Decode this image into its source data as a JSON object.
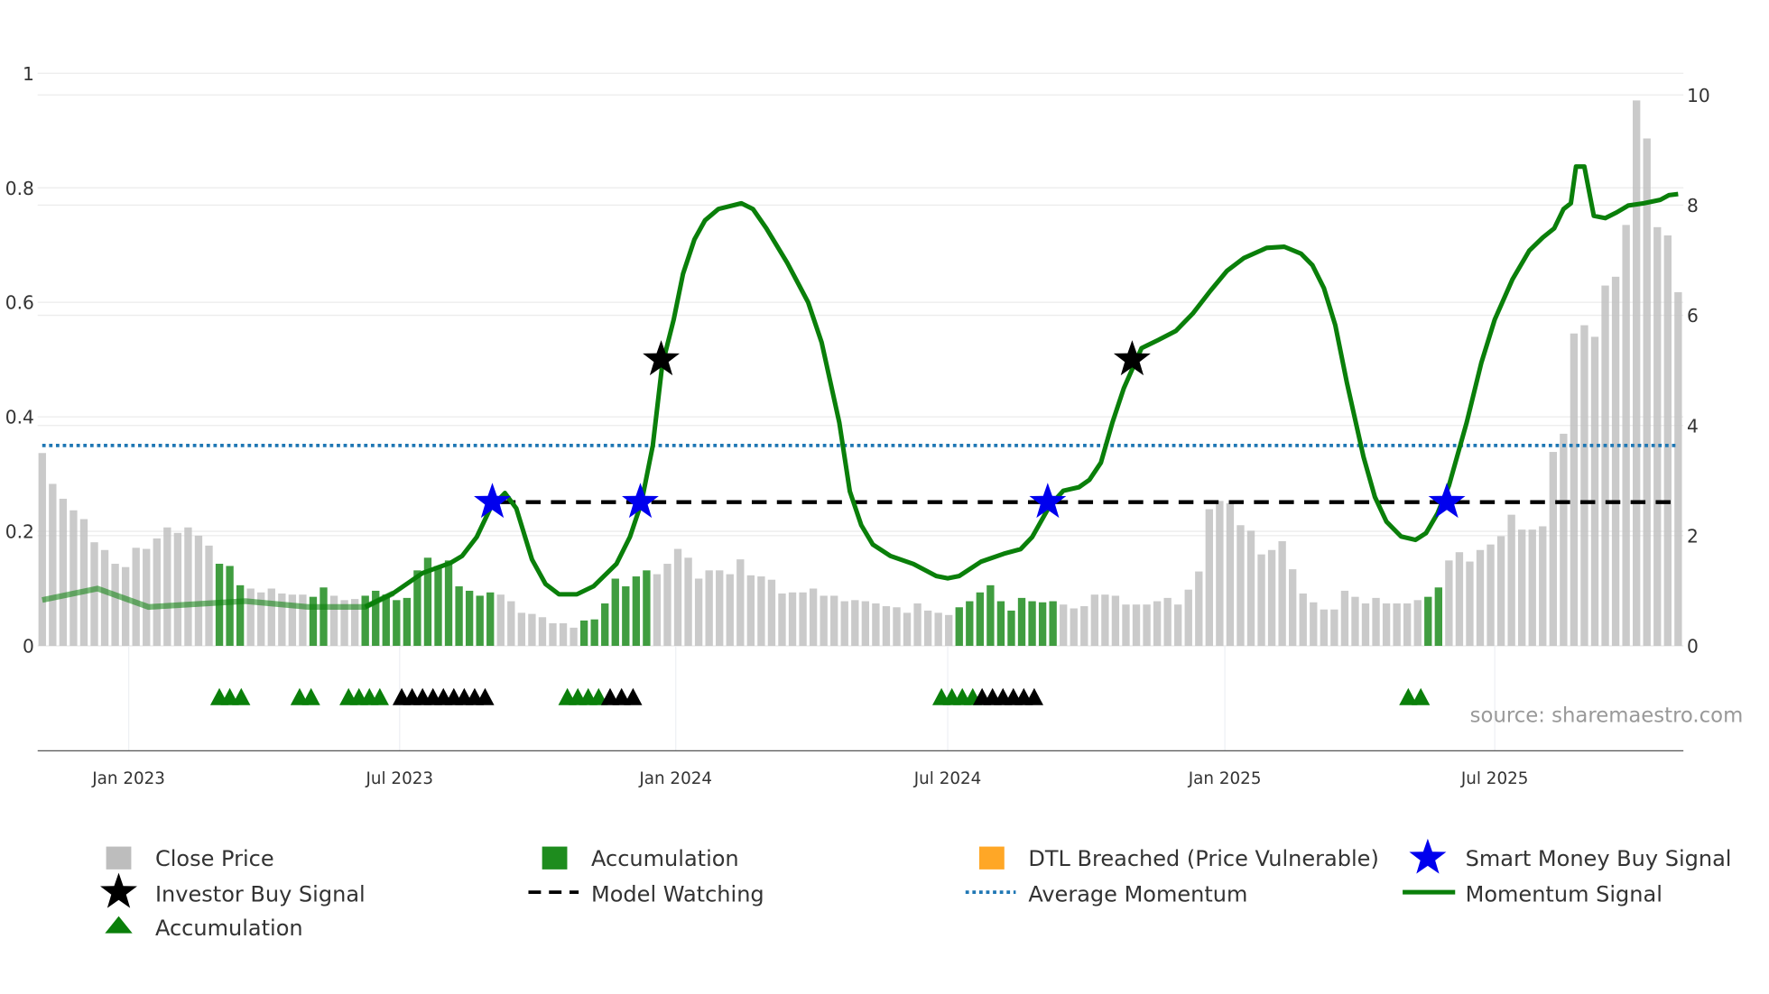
{
  "chart_data": {
    "type": "bar+line",
    "source": "source: sharemaestro.com",
    "left_axis": {
      "range": [
        0,
        1
      ],
      "ticks": [
        "0",
        "0.2",
        "0.4",
        "0.6",
        "0.8",
        "1"
      ]
    },
    "right_axis": {
      "range": [
        0,
        10
      ],
      "ticks": [
        "0",
        "2",
        "4",
        "6",
        "8",
        "10"
      ]
    },
    "x_ticks": [
      {
        "label": "Jan 2023",
        "index": 8.3
      },
      {
        "label": "Jul 2023",
        "index": 34.3
      },
      {
        "label": "Jan 2024",
        "index": 60.8
      },
      {
        "label": "Jul 2024",
        "index": 86.9
      },
      {
        "label": "Jan 2025",
        "index": 113.5
      },
      {
        "label": "Jul 2025",
        "index": 139.4
      }
    ],
    "bars_note": "weekly close price (right axis); second value 1 = accumulation",
    "bars": [
      [
        3.5,
        0
      ],
      [
        2.94,
        0
      ],
      [
        2.67,
        0
      ],
      [
        2.46,
        0
      ],
      [
        2.3,
        0
      ],
      [
        1.88,
        0
      ],
      [
        1.74,
        0
      ],
      [
        1.49,
        0
      ],
      [
        1.43,
        0
      ],
      [
        1.78,
        0
      ],
      [
        1.76,
        0
      ],
      [
        1.95,
        0
      ],
      [
        2.15,
        0
      ],
      [
        2.05,
        0
      ],
      [
        2.15,
        0
      ],
      [
        2.0,
        0
      ],
      [
        1.82,
        0
      ],
      [
        1.49,
        1
      ],
      [
        1.45,
        1
      ],
      [
        1.1,
        1
      ],
      [
        1.04,
        0
      ],
      [
        0.97,
        0
      ],
      [
        1.04,
        0
      ],
      [
        0.95,
        0
      ],
      [
        0.93,
        0
      ],
      [
        0.93,
        0
      ],
      [
        0.89,
        1
      ],
      [
        1.06,
        1
      ],
      [
        0.91,
        0
      ],
      [
        0.83,
        0
      ],
      [
        0.85,
        0
      ],
      [
        0.91,
        1
      ],
      [
        1.0,
        1
      ],
      [
        0.93,
        1
      ],
      [
        0.83,
        1
      ],
      [
        0.87,
        1
      ],
      [
        1.37,
        1
      ],
      [
        1.6,
        1
      ],
      [
        1.45,
        1
      ],
      [
        1.55,
        1
      ],
      [
        1.08,
        1
      ],
      [
        1.0,
        1
      ],
      [
        0.91,
        1
      ],
      [
        0.97,
        1
      ],
      [
        0.93,
        0
      ],
      [
        0.81,
        0
      ],
      [
        0.6,
        0
      ],
      [
        0.58,
        0
      ],
      [
        0.52,
        0
      ],
      [
        0.41,
        0
      ],
      [
        0.41,
        0
      ],
      [
        0.33,
        0
      ],
      [
        0.46,
        1
      ],
      [
        0.48,
        1
      ],
      [
        0.77,
        1
      ],
      [
        1.22,
        1
      ],
      [
        1.08,
        1
      ],
      [
        1.26,
        1
      ],
      [
        1.37,
        1
      ],
      [
        1.3,
        0
      ],
      [
        1.49,
        0
      ],
      [
        1.76,
        0
      ],
      [
        1.6,
        0
      ],
      [
        1.22,
        0
      ],
      [
        1.37,
        0
      ],
      [
        1.37,
        0
      ],
      [
        1.3,
        0
      ],
      [
        1.57,
        0
      ],
      [
        1.28,
        0
      ],
      [
        1.26,
        0
      ],
      [
        1.2,
        0
      ],
      [
        0.95,
        0
      ],
      [
        0.97,
        0
      ],
      [
        0.97,
        0
      ],
      [
        1.04,
        0
      ],
      [
        0.91,
        0
      ],
      [
        0.91,
        0
      ],
      [
        0.81,
        0
      ],
      [
        0.83,
        0
      ],
      [
        0.81,
        0
      ],
      [
        0.77,
        0
      ],
      [
        0.72,
        0
      ],
      [
        0.7,
        0
      ],
      [
        0.6,
        0
      ],
      [
        0.77,
        0
      ],
      [
        0.64,
        0
      ],
      [
        0.6,
        0
      ],
      [
        0.56,
        0
      ],
      [
        0.7,
        1
      ],
      [
        0.81,
        1
      ],
      [
        0.97,
        1
      ],
      [
        1.1,
        1
      ],
      [
        0.81,
        1
      ],
      [
        0.64,
        1
      ],
      [
        0.87,
        1
      ],
      [
        0.81,
        1
      ],
      [
        0.79,
        1
      ],
      [
        0.81,
        1
      ],
      [
        0.75,
        0
      ],
      [
        0.68,
        0
      ],
      [
        0.72,
        0
      ],
      [
        0.93,
        0
      ],
      [
        0.93,
        0
      ],
      [
        0.91,
        0
      ],
      [
        0.75,
        0
      ],
      [
        0.75,
        0
      ],
      [
        0.75,
        0
      ],
      [
        0.81,
        0
      ],
      [
        0.87,
        0
      ],
      [
        0.75,
        0
      ],
      [
        1.02,
        0
      ],
      [
        1.35,
        0
      ],
      [
        2.48,
        0
      ],
      [
        2.63,
        0
      ],
      [
        2.59,
        0
      ],
      [
        2.19,
        0
      ],
      [
        2.09,
        0
      ],
      [
        1.66,
        0
      ],
      [
        1.74,
        0
      ],
      [
        1.9,
        0
      ],
      [
        1.39,
        0
      ],
      [
        0.95,
        0
      ],
      [
        0.79,
        0
      ],
      [
        0.66,
        0
      ],
      [
        0.66,
        0
      ],
      [
        1.0,
        0
      ],
      [
        0.89,
        0
      ],
      [
        0.77,
        0
      ],
      [
        0.87,
        0
      ],
      [
        0.77,
        0
      ],
      [
        0.77,
        0
      ],
      [
        0.77,
        0
      ],
      [
        0.83,
        0
      ],
      [
        0.89,
        1
      ],
      [
        1.06,
        1
      ],
      [
        1.55,
        0
      ],
      [
        1.7,
        0
      ],
      [
        1.53,
        0
      ],
      [
        1.74,
        0
      ],
      [
        1.84,
        0
      ],
      [
        1.99,
        0
      ],
      [
        2.38,
        0
      ],
      [
        2.11,
        0
      ],
      [
        2.11,
        0
      ],
      [
        2.17,
        0
      ],
      [
        3.52,
        0
      ],
      [
        3.85,
        0
      ],
      [
        5.67,
        0
      ],
      [
        5.82,
        0
      ],
      [
        5.61,
        0
      ],
      [
        6.54,
        0
      ],
      [
        6.7,
        0
      ],
      [
        7.64,
        0
      ],
      [
        9.9,
        0
      ],
      [
        9.21,
        0
      ],
      [
        7.6,
        0
      ],
      [
        7.45,
        0
      ],
      [
        6.42,
        0
      ]
    ],
    "momentum_faded_until_index": 32,
    "momentum": [
      [
        0,
        0.08
      ],
      [
        5.3,
        0.1
      ],
      [
        10.2,
        0.068
      ],
      [
        19.5,
        0.078
      ],
      [
        25.5,
        0.068
      ],
      [
        31,
        0.068
      ],
      [
        33.7,
        0.092
      ],
      [
        36.5,
        0.127
      ],
      [
        39.2,
        0.145
      ],
      [
        40.3,
        0.157
      ],
      [
        41.7,
        0.19
      ],
      [
        43,
        0.24
      ],
      [
        44.4,
        0.267
      ],
      [
        45.5,
        0.24
      ],
      [
        47,
        0.151
      ],
      [
        48.3,
        0.108
      ],
      [
        49.6,
        0.09
      ],
      [
        51.3,
        0.09
      ],
      [
        52.9,
        0.104
      ],
      [
        55.1,
        0.143
      ],
      [
        56.4,
        0.19
      ],
      [
        57.5,
        0.25
      ],
      [
        58.6,
        0.35
      ],
      [
        59.5,
        0.49
      ],
      [
        60.6,
        0.57
      ],
      [
        61.5,
        0.65
      ],
      [
        62.6,
        0.71
      ],
      [
        63.6,
        0.743
      ],
      [
        64.9,
        0.763
      ],
      [
        67.1,
        0.773
      ],
      [
        68.2,
        0.763
      ],
      [
        69.5,
        0.729
      ],
      [
        71.5,
        0.669
      ],
      [
        73.5,
        0.6
      ],
      [
        74.8,
        0.53
      ],
      [
        76.5,
        0.39
      ],
      [
        77.5,
        0.27
      ],
      [
        78.6,
        0.211
      ],
      [
        79.7,
        0.177
      ],
      [
        81.4,
        0.157
      ],
      [
        83.6,
        0.143
      ],
      [
        85.8,
        0.122
      ],
      [
        86.9,
        0.118
      ],
      [
        88,
        0.122
      ],
      [
        90.1,
        0.147
      ],
      [
        92.3,
        0.161
      ],
      [
        93.9,
        0.169
      ],
      [
        95,
        0.19
      ],
      [
        96.7,
        0.245
      ],
      [
        98,
        0.271
      ],
      [
        99.5,
        0.277
      ],
      [
        100.5,
        0.29
      ],
      [
        101.6,
        0.32
      ],
      [
        102.7,
        0.39
      ],
      [
        103.8,
        0.45
      ],
      [
        105.5,
        0.52
      ],
      [
        107.1,
        0.534
      ],
      [
        108.8,
        0.55
      ],
      [
        110.4,
        0.58
      ],
      [
        112.1,
        0.62
      ],
      [
        113.7,
        0.655
      ],
      [
        115.3,
        0.677
      ],
      [
        117.5,
        0.695
      ],
      [
        119.2,
        0.697
      ],
      [
        120.8,
        0.685
      ],
      [
        121.9,
        0.665
      ],
      [
        123,
        0.625
      ],
      [
        124.1,
        0.56
      ],
      [
        125.2,
        0.46
      ],
      [
        126.8,
        0.33
      ],
      [
        127.9,
        0.26
      ],
      [
        129,
        0.217
      ],
      [
        130.4,
        0.191
      ],
      [
        131.8,
        0.185
      ],
      [
        132.8,
        0.197
      ],
      [
        133.9,
        0.231
      ],
      [
        135,
        0.28
      ],
      [
        136.7,
        0.39
      ],
      [
        138.1,
        0.494
      ],
      [
        139.4,
        0.57
      ],
      [
        141.1,
        0.64
      ],
      [
        142.7,
        0.69
      ],
      [
        144,
        0.713
      ],
      [
        145.1,
        0.729
      ],
      [
        146,
        0.763
      ],
      [
        146.7,
        0.773
      ],
      [
        147.2,
        0.837
      ],
      [
        148,
        0.837
      ],
      [
        148.9,
        0.751
      ],
      [
        150,
        0.747
      ],
      [
        151.1,
        0.757
      ],
      [
        152.2,
        0.769
      ],
      [
        153.7,
        0.773
      ],
      [
        155.3,
        0.779
      ],
      [
        156.1,
        0.787
      ],
      [
        157,
        0.789
      ]
    ],
    "average_momentum": 0.35,
    "model_watching": {
      "value": 0.251,
      "from_index": 44,
      "to_index": 157
    },
    "smart_money_buy_signals": [
      [
        43.2,
        0.251
      ],
      [
        57.4,
        0.251
      ],
      [
        96.5,
        0.251
      ],
      [
        134.8,
        0.251
      ]
    ],
    "investor_buy_signals": [
      [
        59.4,
        0.5
      ],
      [
        104.6,
        0.5
      ]
    ],
    "accumulation_markers_green": [
      17,
      18,
      19.1,
      24.7,
      25.8,
      29.4,
      30.4,
      31.4,
      32.4,
      50.4,
      51.4,
      52.4,
      53.4,
      86.3,
      87.3,
      88.3,
      89.3,
      131.1,
      132.3
    ],
    "accumulation_markers_black": [
      34.5,
      35.5,
      36.5,
      37.5,
      38.5,
      39.5,
      40.5,
      41.5,
      42.5,
      54.5,
      55.6,
      56.7,
      90.2,
      91.2,
      92.2,
      93.2,
      94.2,
      95.2
    ],
    "colors": {
      "close": "#c4c4c4",
      "accumulation": "#2e8b2e",
      "dtl": "#ffa726",
      "smart": "#0000ee",
      "investor": "#000000",
      "avg": "#1f77b4",
      "momentum": "#0a7f0a"
    },
    "legend": [
      "Close Price",
      "Accumulation",
      "DTL Breached (Price Vulnerable)",
      "Smart Money Buy Signal",
      "Investor Buy Signal",
      "Model Watching",
      "Average Momentum",
      "Momentum Signal",
      "Accumulation"
    ]
  }
}
